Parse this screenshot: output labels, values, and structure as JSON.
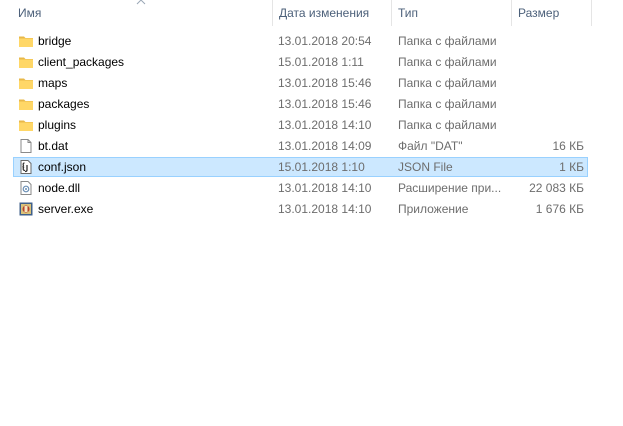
{
  "columns": {
    "name": "Имя",
    "date": "Дата изменения",
    "type": "Тип",
    "size": "Размер"
  },
  "files": [
    {
      "name": "bridge",
      "date": "13.01.2018 20:54",
      "type": "Папка с файлами",
      "size": "",
      "icon": "folder-icon"
    },
    {
      "name": "client_packages",
      "date": "15.01.2018 1:11",
      "type": "Папка с файлами",
      "size": "",
      "icon": "folder-icon"
    },
    {
      "name": "maps",
      "date": "13.01.2018 15:46",
      "type": "Папка с файлами",
      "size": "",
      "icon": "folder-icon"
    },
    {
      "name": "packages",
      "date": "13.01.2018 15:46",
      "type": "Папка с файлами",
      "size": "",
      "icon": "folder-icon"
    },
    {
      "name": "plugins",
      "date": "13.01.2018 14:10",
      "type": "Папка с файлами",
      "size": "",
      "icon": "folder-icon"
    },
    {
      "name": "bt.dat",
      "date": "13.01.2018 14:09",
      "type": "Файл \"DAT\"",
      "size": "16 КБ",
      "icon": "file-icon"
    },
    {
      "name": "conf.json",
      "date": "15.01.2018 1:10",
      "type": "JSON File",
      "size": "1 КБ",
      "icon": "json-file-icon",
      "selected": true
    },
    {
      "name": "node.dll",
      "date": "13.01.2018 14:10",
      "type": "Расширение при...",
      "size": "22 083 КБ",
      "icon": "dll-file-icon"
    },
    {
      "name": "server.exe",
      "date": "13.01.2018 14:10",
      "type": "Приложение",
      "size": "1 676 КБ",
      "icon": "exe-app-icon"
    }
  ],
  "colors": {
    "folder": "#ffd767",
    "selection_bg": "#cce8ff",
    "selection_border": "#99d1ff",
    "header_text": "#4c607a"
  }
}
